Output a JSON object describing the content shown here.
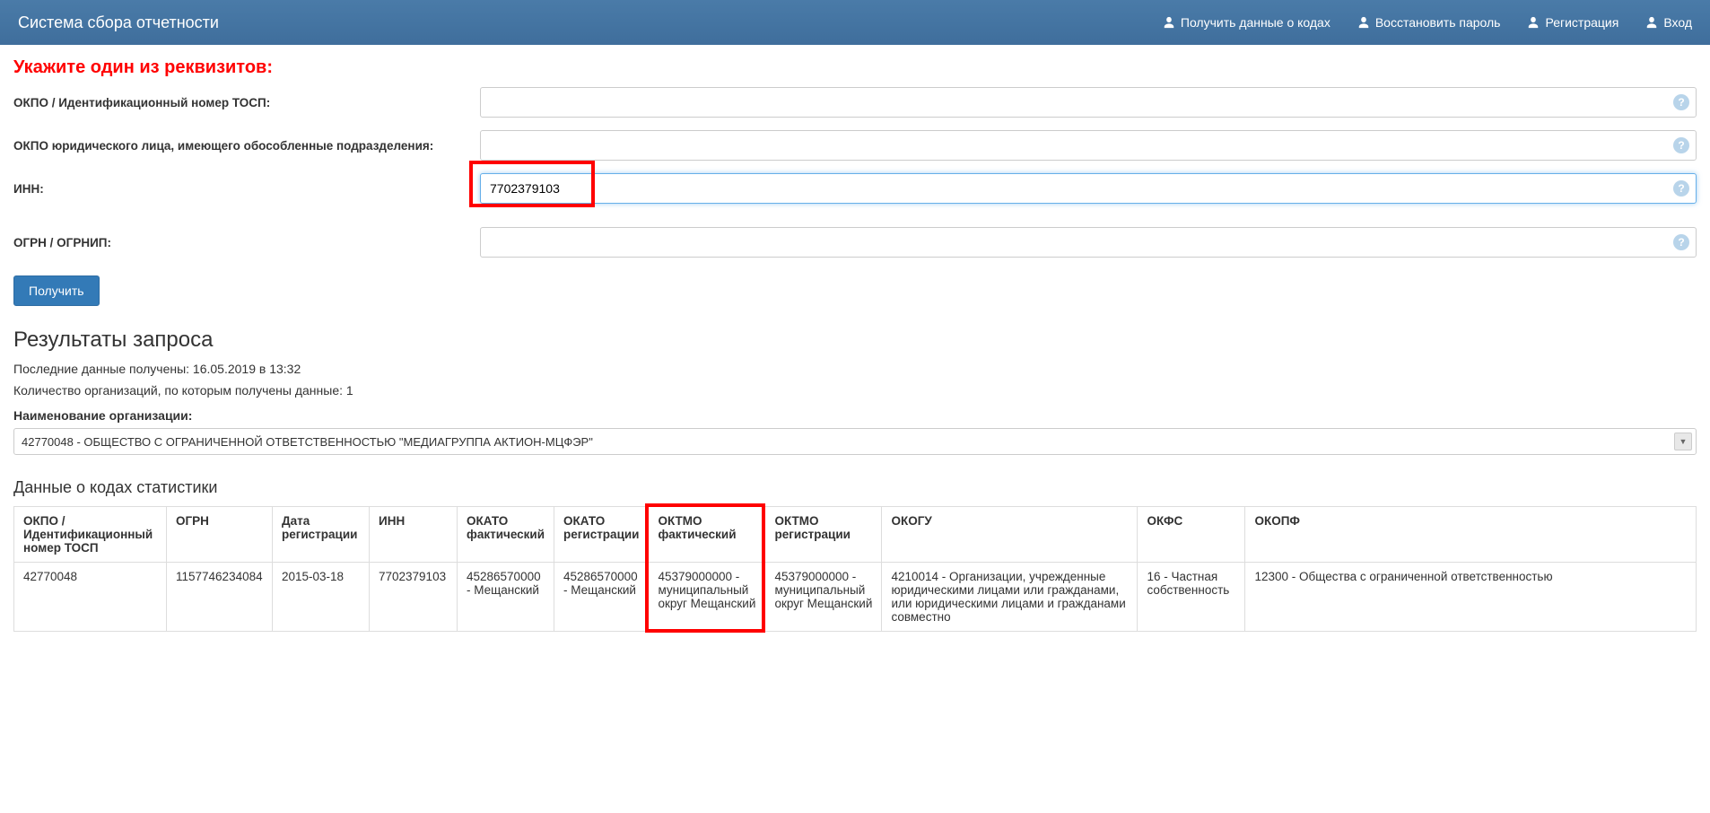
{
  "navbar": {
    "title": "Система сбора отчетности",
    "links": [
      "Получить данные о кодах",
      "Восстановить пароль",
      "Регистрация",
      "Вход"
    ]
  },
  "form": {
    "heading": "Укажите один из реквизитов:",
    "label_okpo": "ОКПО / Идентификационный номер ТОСП:",
    "label_okpo_jur": "ОКПО юридического лица, имеющего обособленные подразделения:",
    "label_inn": "ИНН:",
    "label_ogrn": "ОГРН / ОГРНИП:",
    "value_okpo": "",
    "value_okpo_jur": "",
    "value_inn": "7702379103",
    "value_ogrn": "",
    "submit": "Получить",
    "help": "?"
  },
  "results": {
    "heading": "Результаты запроса",
    "fetched": "Последние данные получены: 16.05.2019 в 13:32",
    "count": "Количество организаций, по которым получены данные: 1",
    "org_label": "Наименование организации:",
    "org_value": "42770048 - ОБЩЕСТВО С ОГРАНИЧЕННОЙ ОТВЕТСТВЕННОСТЬЮ \"МЕДИАГРУППА АКТИОН-МЦФЭР\""
  },
  "stats": {
    "heading": "Данные о кодах статистики",
    "headers": [
      "ОКПО / Идентификационный номер ТОСП",
      "ОГРН",
      "Дата регистрации",
      "ИНН",
      "ОКАТО фактический",
      "ОКАТО регистрации",
      "ОКТМО фактический",
      "ОКТМО регистрации",
      "ОКОГУ",
      "ОКФС",
      "ОКОПФ"
    ],
    "row": [
      "42770048",
      "1157746234084",
      "2015-03-18",
      "7702379103",
      "45286570000 - Мещанский",
      "45286570000 - Мещанский",
      "45379000000 - муниципальный округ Мещанский",
      "45379000000 - муниципальный округ Мещанский",
      "4210014 - Организации, учрежденные юридическими лицами или гражданами, или юридическими лицами и гражданами совместно",
      "16 - Частная собственность",
      "12300 - Общества с ограниченной ответственностью"
    ]
  }
}
